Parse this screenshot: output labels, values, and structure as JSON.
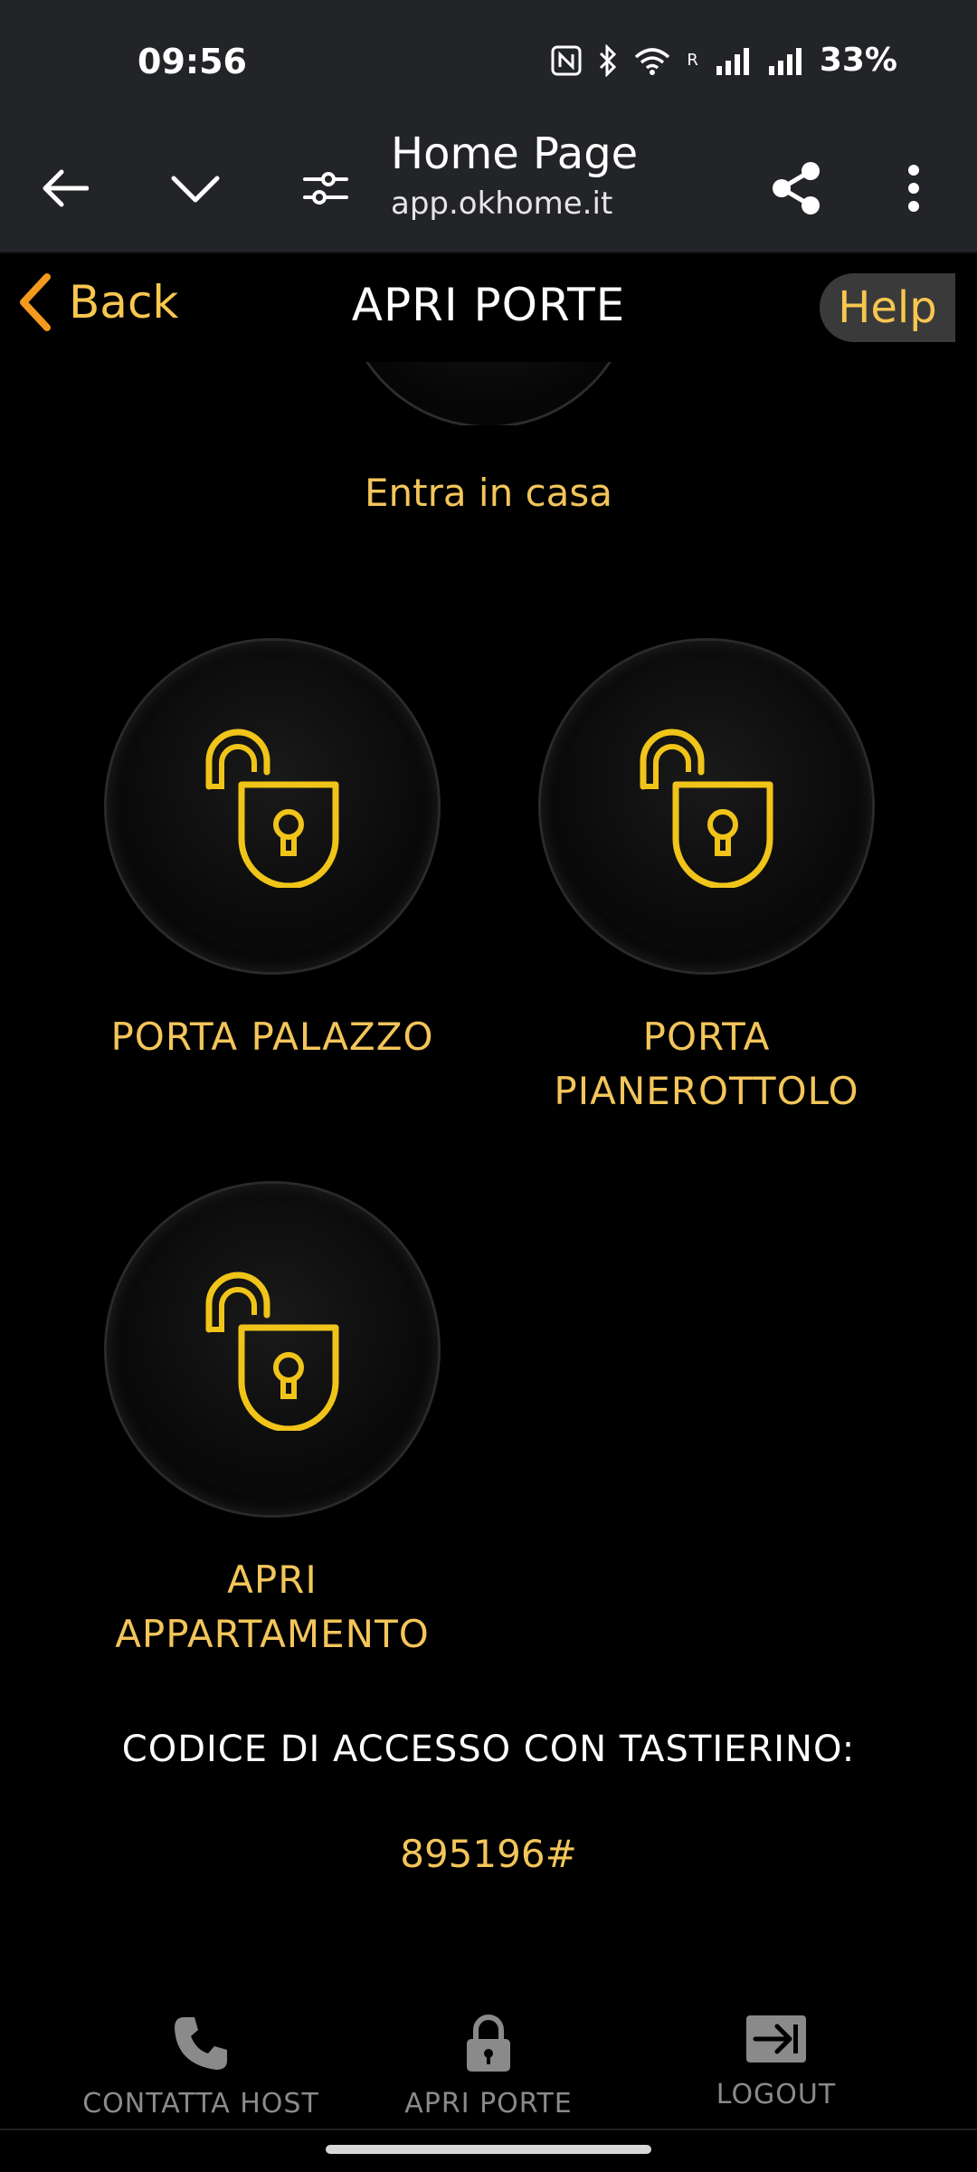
{
  "status_bar": {
    "time": "09:56",
    "network_label": "R",
    "battery": "33%"
  },
  "browser": {
    "page_title": "Home Page",
    "url": "app.okhome.it"
  },
  "header": {
    "back_label": "Back",
    "title": "APRI PORTE",
    "help_label": "Help"
  },
  "main": {
    "top_caption": "Entra in casa",
    "doors": [
      {
        "line1": "PORTA PALAZZO",
        "line2": ""
      },
      {
        "line1": "PORTA",
        "line2": "PIANEROTTOLO"
      },
      {
        "line1": "APRI",
        "line2": "APPARTAMENTO"
      }
    ],
    "access_label": "CODICE DI ACCESSO CON TASTIERINO:",
    "access_code": "895196#"
  },
  "bottom_nav": [
    {
      "label": "CONTATTA HOST",
      "icon": "phone-icon"
    },
    {
      "label": "APRI PORTE",
      "icon": "lock-icon"
    },
    {
      "label": "LOGOUT",
      "icon": "logout-icon"
    }
  ],
  "colors": {
    "accent": "#f3c55a",
    "lock_icon": "#f0c419",
    "back_chevron": "#f39a1e"
  }
}
